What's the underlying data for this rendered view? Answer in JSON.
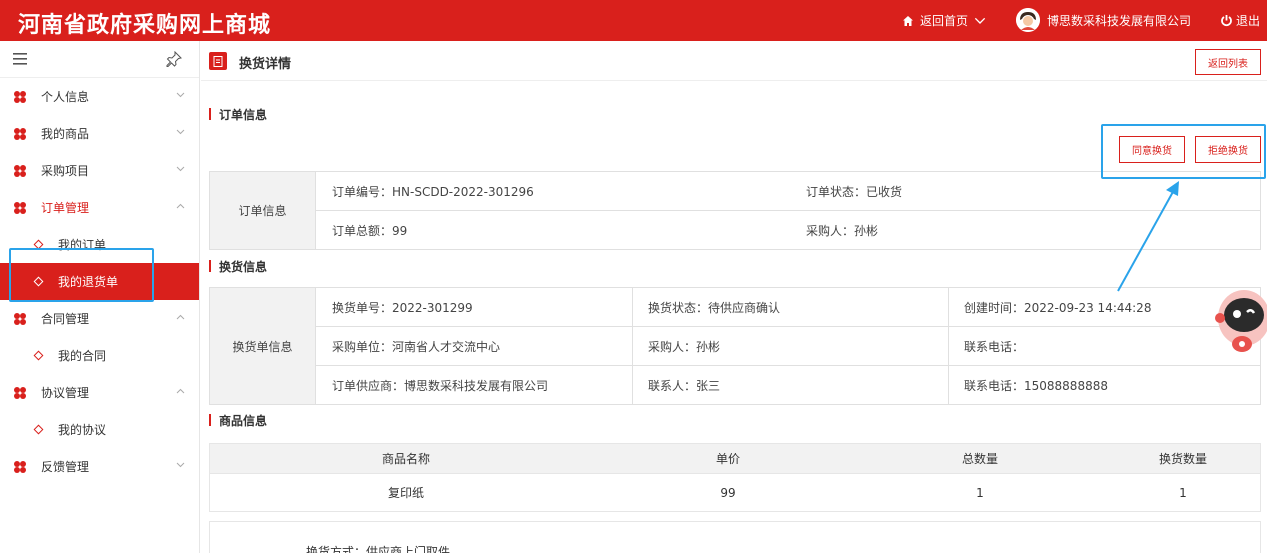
{
  "header": {
    "brand": "河南省政府采购网上商城",
    "home": "返回首页",
    "company": "博思数采科技发展有限公司",
    "logout": "退出"
  },
  "sidebar": {
    "items": [
      {
        "label": "个人信息"
      },
      {
        "label": "我的商品"
      },
      {
        "label": "采购项目"
      },
      {
        "label": "订单管理"
      },
      {
        "label": "我的订单"
      },
      {
        "label": "我的退货单"
      },
      {
        "label": "合同管理"
      },
      {
        "label": "我的合同"
      },
      {
        "label": "协议管理"
      },
      {
        "label": "我的协议"
      },
      {
        "label": "反馈管理"
      }
    ]
  },
  "page": {
    "title": "换货详情",
    "back_btn": "返回列表",
    "agree_btn": "同意换货",
    "reject_btn": "拒绝换货"
  },
  "order": {
    "section": "订单信息",
    "label": "订单信息",
    "no": "订单编号：HN-SCDD-2022-301296",
    "status": "订单状态：已收货",
    "total": "订单总额：99",
    "buyer": "采购人：孙彬"
  },
  "exchange": {
    "section": "换货信息",
    "label": "换货单信息",
    "no": "换货单号：2022-301299",
    "status": "换货状态：待供应商确认",
    "created": "创建时间：2022-09-23 14:44:28",
    "unit": "采购单位：河南省人才交流中心",
    "buyer": "采购人：孙彬",
    "phone1": "联系电话：",
    "supplier": "订单供应商：博思数采科技发展有限公司",
    "contact": "联系人：张三",
    "phone2": "联系电话：15088888888"
  },
  "goods": {
    "section": "商品信息",
    "headers": [
      "商品名称",
      "单价",
      "总数量",
      "换货数量"
    ],
    "row": [
      "复印纸",
      "99",
      "1",
      "1"
    ]
  },
  "method": "换货方式：供应商上门取件",
  "colors": {
    "brand": "#d9201c",
    "highlight": "#2aa3ea"
  }
}
